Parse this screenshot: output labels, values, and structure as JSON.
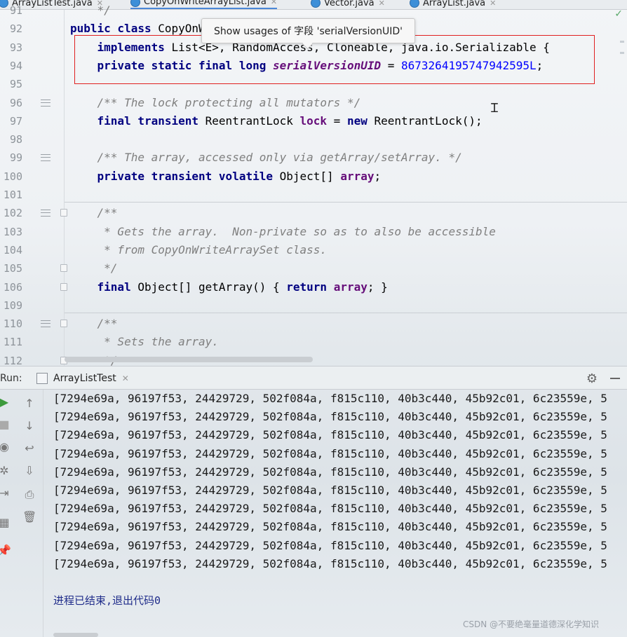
{
  "tabs": [
    {
      "label": "ArrayListTest.java",
      "active": false
    },
    {
      "label": "CopyOnWriteArrayList.java",
      "active": true
    },
    {
      "label": "Vector.java",
      "active": false
    },
    {
      "label": "ArrayList.java",
      "active": false
    }
  ],
  "editor": {
    "tooltip": "Show usages of 字段 'serialVersionUID'",
    "lines": [
      {
        "num": "91",
        "tokens": [
          {
            "t": "    */",
            "c": "cm"
          }
        ]
      },
      {
        "num": "92",
        "tokens": [
          {
            "t": "public class ",
            "c": "kw"
          },
          {
            "t": "CopyOnWriteArrayList<E>",
            "c": ""
          }
        ]
      },
      {
        "num": "93",
        "tokens": [
          {
            "t": "    implements ",
            "c": "kw"
          },
          {
            "t": "List<E>, RandomAccess, Cloneable, java.io.Serializable {",
            "c": ""
          }
        ]
      },
      {
        "num": "94",
        "tokens": [
          {
            "t": "    private static final long ",
            "c": "kw"
          },
          {
            "t": "serialVersionUID",
            "c": "sfld"
          },
          {
            "t": " = ",
            "c": ""
          },
          {
            "t": "8673264195747942595L",
            "c": "num"
          },
          {
            "t": ";",
            "c": ""
          }
        ]
      },
      {
        "num": "95",
        "tokens": []
      },
      {
        "num": "96",
        "tokens": [
          {
            "t": "    /** The lock protecting all mutators */",
            "c": "cm"
          }
        ]
      },
      {
        "num": "97",
        "tokens": [
          {
            "t": "    final transient ",
            "c": "kw"
          },
          {
            "t": "ReentrantLock ",
            "c": ""
          },
          {
            "t": "lock",
            "c": "fld"
          },
          {
            "t": " = ",
            "c": ""
          },
          {
            "t": "new ",
            "c": "kw"
          },
          {
            "t": "ReentrantLock();",
            "c": ""
          }
        ]
      },
      {
        "num": "98",
        "tokens": []
      },
      {
        "num": "99",
        "tokens": [
          {
            "t": "    /** The array, accessed only via getArray/setArray. */",
            "c": "cm"
          }
        ]
      },
      {
        "num": "100",
        "tokens": [
          {
            "t": "    private transient volatile ",
            "c": "kw"
          },
          {
            "t": "Object[] ",
            "c": ""
          },
          {
            "t": "array",
            "c": "fld"
          },
          {
            "t": ";",
            "c": ""
          }
        ]
      },
      {
        "num": "101",
        "tokens": []
      },
      {
        "num": "102",
        "tokens": [
          {
            "t": "    /**",
            "c": "cm"
          }
        ]
      },
      {
        "num": "103",
        "tokens": [
          {
            "t": "     * Gets the array.  Non-private so as to also be accessible",
            "c": "cm"
          }
        ]
      },
      {
        "num": "104",
        "tokens": [
          {
            "t": "     * from CopyOnWriteArraySet class.",
            "c": "cm"
          }
        ]
      },
      {
        "num": "105",
        "tokens": [
          {
            "t": "     */",
            "c": "cm"
          }
        ]
      },
      {
        "num": "106",
        "tokens": [
          {
            "t": "    final ",
            "c": "kw"
          },
          {
            "t": "Object[] getArray() { ",
            "c": ""
          },
          {
            "t": "return ",
            "c": "kw"
          },
          {
            "t": "array",
            "c": "fld"
          },
          {
            "t": "; }",
            "c": ""
          }
        ]
      },
      {
        "num": "109",
        "tokens": []
      },
      {
        "num": "110",
        "tokens": [
          {
            "t": "    /**",
            "c": "cm"
          }
        ]
      },
      {
        "num": "111",
        "tokens": [
          {
            "t": "     * Sets the array.",
            "c": "cm"
          }
        ]
      },
      {
        "num": "112",
        "tokens": [
          {
            "t": "     */",
            "c": "cm"
          }
        ]
      }
    ]
  },
  "run": {
    "label": "Run:",
    "tab_label": "ArrayListTest",
    "output_lines": [
      "[7294e69a, 96197f53, 24429729, 502f084a, f815c110, 40b3c440, 45b92c01, 6c23559e, 5",
      "[7294e69a, 96197f53, 24429729, 502f084a, f815c110, 40b3c440, 45b92c01, 6c23559e, 5",
      "[7294e69a, 96197f53, 24429729, 502f084a, f815c110, 40b3c440, 45b92c01, 6c23559e, 5",
      "[7294e69a, 96197f53, 24429729, 502f084a, f815c110, 40b3c440, 45b92c01, 6c23559e, 5",
      "[7294e69a, 96197f53, 24429729, 502f084a, f815c110, 40b3c440, 45b92c01, 6c23559e, 5",
      "[7294e69a, 96197f53, 24429729, 502f084a, f815c110, 40b3c440, 45b92c01, 6c23559e, 5",
      "[7294e69a, 96197f53, 24429729, 502f084a, f815c110, 40b3c440, 45b92c01, 6c23559e, 5",
      "[7294e69a, 96197f53, 24429729, 502f084a, f815c110, 40b3c440, 45b92c01, 6c23559e, 5",
      "[7294e69a, 96197f53, 24429729, 502f084a, f815c110, 40b3c440, 45b92c01, 6c23559e, 5",
      "[7294e69a, 96197f53, 24429729, 502f084a, f815c110, 40b3c440, 45b92c01, 6c23559e, 5"
    ],
    "exit_message": "进程已结束,退出代码0"
  },
  "watermark": "CSDN @不要绝毫量道德深化学知识",
  "colors": {
    "keyword": "#000080",
    "comment": "#7f7f7f",
    "field": "#660e7a",
    "number": "#0000ff",
    "highlight_box": "#e02020"
  }
}
